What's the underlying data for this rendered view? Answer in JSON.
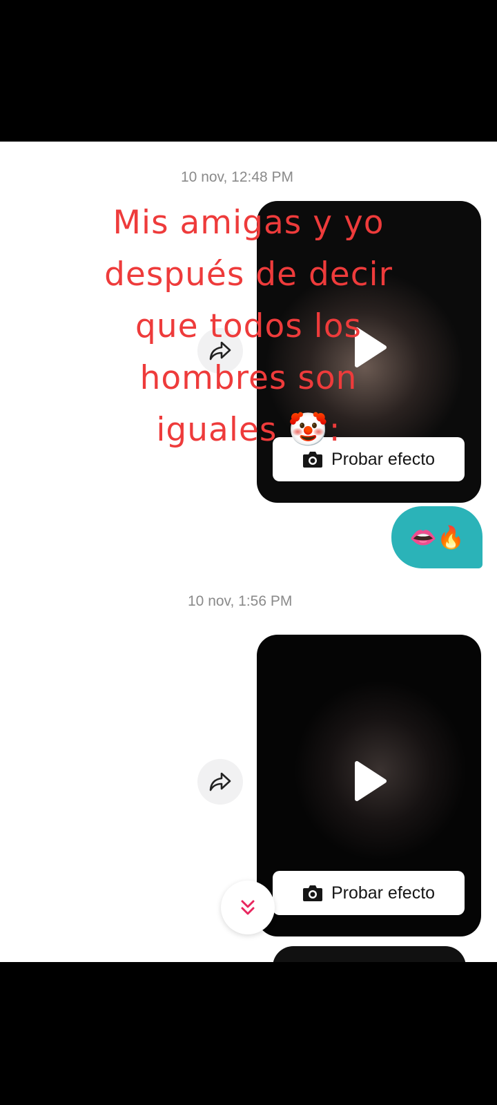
{
  "caption": {
    "lines": [
      "Mis amigas y yo",
      "después de decir",
      "que todos los",
      "hombres son",
      "iguales 🤡:"
    ]
  },
  "conversation": [
    {
      "timestamp": "10 nov, 12:48 PM",
      "video": {
        "effect_button_label": "Probar efecto"
      },
      "reply": "👄🔥"
    },
    {
      "timestamp": "10 nov, 1:56 PM",
      "video": {
        "effect_button_label": "Probar efecto"
      }
    }
  ],
  "icons": {
    "share": "share-arrow-icon",
    "play": "play-icon",
    "camera": "camera-icon",
    "scroll": "double-chevron-down-icon"
  },
  "colors": {
    "caption": "#ee3b3b",
    "reply_bubble": "#2bb3b8",
    "scroll_icon": "#e8265e"
  }
}
